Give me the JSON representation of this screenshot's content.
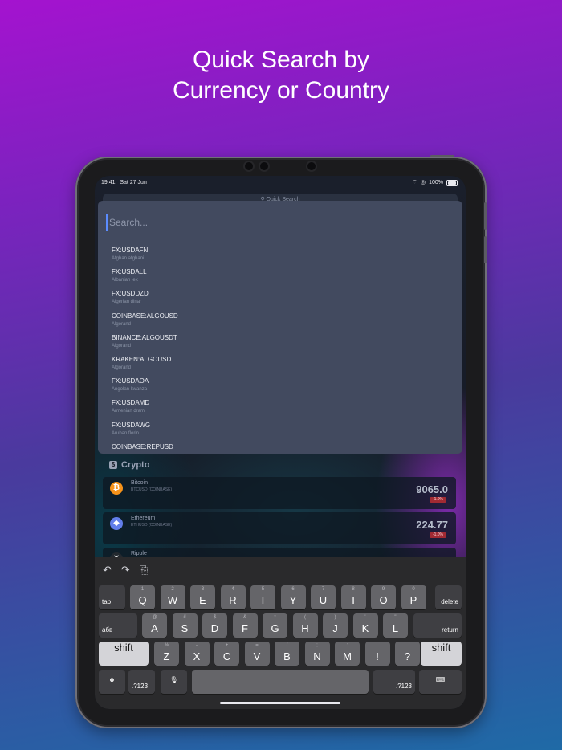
{
  "headline": {
    "line1": "Quick Search by",
    "line2": "Currency or Country"
  },
  "status_bar": {
    "time": "19:41",
    "date": "Sat 27 Jun",
    "battery": "100%"
  },
  "background_search": {
    "placeholder": "Quick Search"
  },
  "search": {
    "placeholder": "Search...",
    "results": [
      {
        "symbol": "FX:USDAFN",
        "name": "Afghan afghani"
      },
      {
        "symbol": "FX:USDALL",
        "name": "Albanian lek"
      },
      {
        "symbol": "FX:USDDZD",
        "name": "Algerian dinar"
      },
      {
        "symbol": "COINBASE:ALGOUSD",
        "name": "Algorand"
      },
      {
        "symbol": "BINANCE:ALGOUSDT",
        "name": "Algorand"
      },
      {
        "symbol": "KRAKEN:ALGOUSD",
        "name": "Algorand"
      },
      {
        "symbol": "FX:USDAOA",
        "name": "Angolan kwanza"
      },
      {
        "symbol": "FX:USDAMD",
        "name": "Armenian dram"
      },
      {
        "symbol": "FX:USDAWG",
        "name": "Aruban florin"
      },
      {
        "symbol": "COINBASE:REPUSD",
        "name": ""
      }
    ]
  },
  "crypto": {
    "title": "Crypto",
    "coins": [
      {
        "name": "Bitcoin",
        "pair": "BTCUSD (COINBASE)",
        "price": "9065.0",
        "change": "-1.0%",
        "color": "#f7931a",
        "glyph": "₿"
      },
      {
        "name": "Ethereum",
        "pair": "ETHUSD (COINBASE)",
        "price": "224.77",
        "change": "-1.0%",
        "color": "#627eea",
        "glyph": "◆"
      },
      {
        "name": "Ripple",
        "pair": "",
        "price": "",
        "change": "",
        "color": "#23292f",
        "glyph": "✕"
      }
    ]
  },
  "keyboard": {
    "row1": [
      {
        "alt": "1",
        "main": "Q"
      },
      {
        "alt": "2",
        "main": "W"
      },
      {
        "alt": "3",
        "main": "E"
      },
      {
        "alt": "4",
        "main": "R"
      },
      {
        "alt": "5",
        "main": "T"
      },
      {
        "alt": "6",
        "main": "Y"
      },
      {
        "alt": "7",
        "main": "U"
      },
      {
        "alt": "8",
        "main": "I"
      },
      {
        "alt": "9",
        "main": "O"
      },
      {
        "alt": "0",
        "main": "P"
      }
    ],
    "row2": [
      {
        "alt": "@",
        "main": "A"
      },
      {
        "alt": "#",
        "main": "S"
      },
      {
        "alt": "$",
        "main": "D"
      },
      {
        "alt": "&",
        "main": "F"
      },
      {
        "alt": "*",
        "main": "G"
      },
      {
        "alt": "(",
        "main": "H"
      },
      {
        "alt": ")",
        "main": "J"
      },
      {
        "alt": "'",
        "main": "K"
      },
      {
        "alt": "\"",
        "main": "L"
      }
    ],
    "row3": [
      {
        "alt": "%",
        "main": "Z"
      },
      {
        "alt": "-",
        "main": "X"
      },
      {
        "alt": "+",
        "main": "C"
      },
      {
        "alt": "=",
        "main": "V"
      },
      {
        "alt": "/",
        "main": "B"
      },
      {
        "alt": ";",
        "main": "N"
      },
      {
        "alt": ":",
        "main": "M"
      },
      {
        "alt": "",
        "main": "!"
      },
      {
        "alt": "",
        "main": "?"
      }
    ],
    "tab": "tab",
    "delete": "delete",
    "lang": "абв",
    "return": "return",
    "shift": "shift",
    "num": ".?123"
  }
}
